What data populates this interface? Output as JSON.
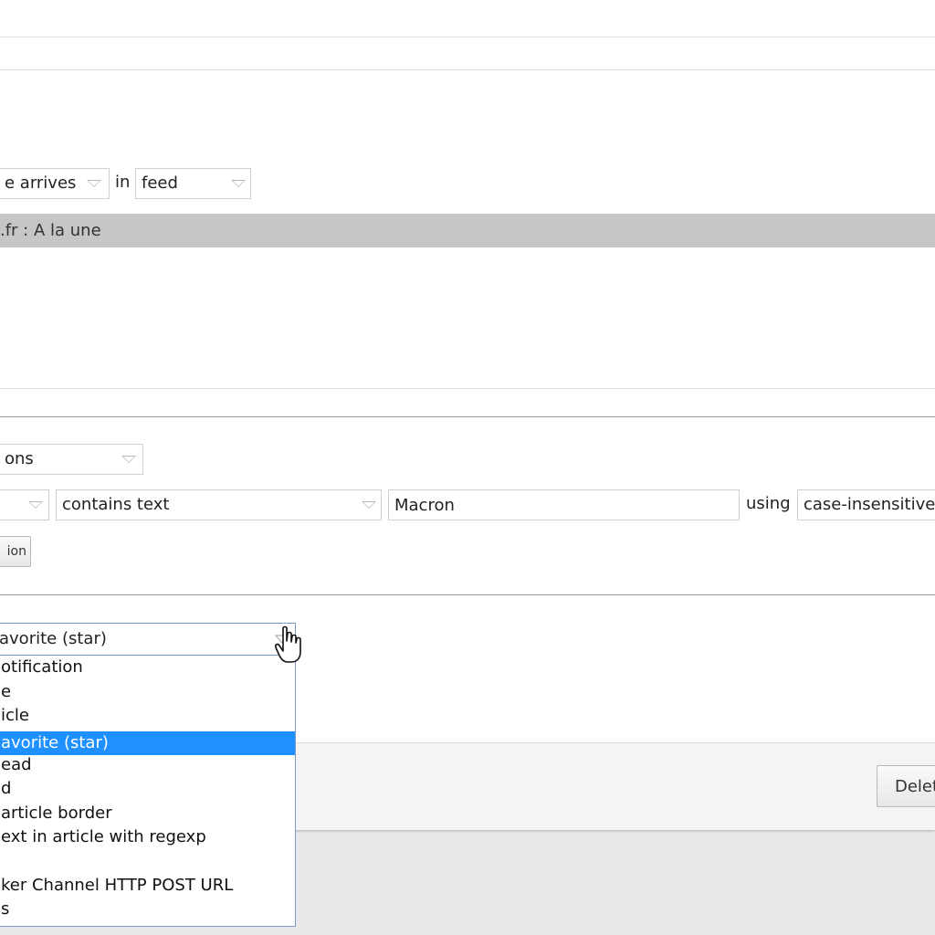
{
  "rule": {
    "event_select": "e arrives",
    "in_label": "in",
    "scope_select": "feed",
    "feed_item": ".fr : A la une"
  },
  "conditions": {
    "match_select": "ons",
    "field_select": "",
    "operator_select": "contains text",
    "value": "Macron",
    "using_label": "using",
    "case_select": "case-insensitive",
    "add_button": "ion"
  },
  "actions": {
    "selected": "avorite (star)",
    "options": [
      "otification",
      "e",
      "icle",
      "avorite (star)",
      "ead",
      "d",
      "article border",
      "ext in article with regexp",
      "",
      "ker Channel HTTP POST URL",
      "s"
    ],
    "selected_index": 3
  },
  "footer": {
    "delete_button": "Delete"
  },
  "colors": {
    "highlight": "#1e90ff",
    "feed_row_bg": "#c6c6c6",
    "dropdown_border": "#7a9cc9"
  }
}
